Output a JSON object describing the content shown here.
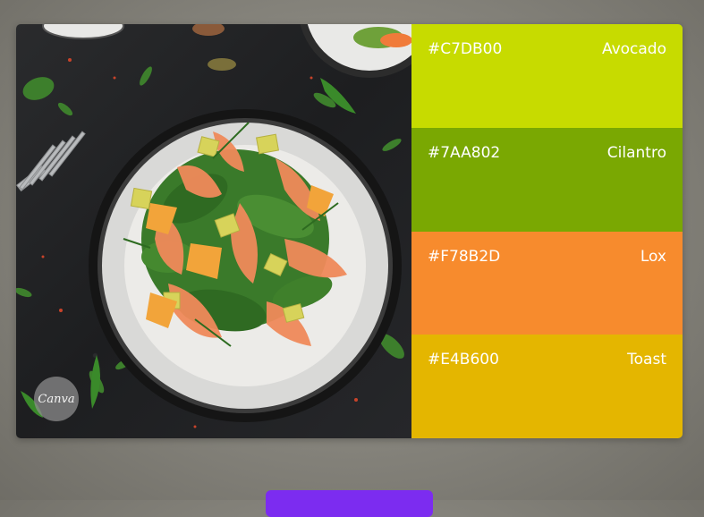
{
  "photo": {
    "badge_text": "Canva"
  },
  "palette": {
    "swatches": [
      {
        "hex": "#C7DB00",
        "name": "Avocado",
        "color": "#C7DB00"
      },
      {
        "hex": "#7AA802",
        "name": "Cilantro",
        "color": "#7AA802"
      },
      {
        "hex": "#F78B2D",
        "name": "Lox",
        "color": "#F78B2D"
      },
      {
        "hex": "#E4B600",
        "name": "Toast",
        "color": "#E4B600"
      }
    ]
  },
  "colors": {
    "button": "#7C2CF0",
    "background": "#8A8880"
  }
}
